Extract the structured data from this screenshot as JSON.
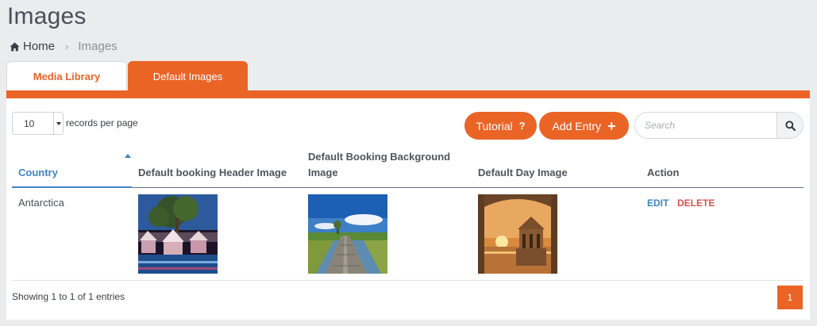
{
  "page": {
    "title": "Images"
  },
  "breadcrumb": {
    "home": "Home",
    "separator": "›",
    "current": "Images"
  },
  "tabs": [
    {
      "label": "Media Library",
      "active": false
    },
    {
      "label": "Default Images",
      "active": true
    }
  ],
  "colors": {
    "accent": "#ea6426",
    "link": "#3e85c6",
    "danger": "#d9534f"
  },
  "controls": {
    "page_length": "10",
    "records_label": "records per page",
    "tutorial_label": "Tutorial",
    "tutorial_icon": "?",
    "add_label": "Add Entry",
    "add_icon": "+",
    "search_placeholder": "Search"
  },
  "table": {
    "columns": [
      "Country",
      "Default booking Header Image",
      "Default Booking Background Image",
      "Default Day Image",
      "Action"
    ],
    "sorted_column": "Country",
    "rows": [
      {
        "country": "Antarctica",
        "header_image": "resort-pool-cabanas-image",
        "background_image": "boardwalk-lake-image",
        "day_image": "sunset-pavilion-image",
        "edit": "EDIT",
        "delete": "DELETE"
      }
    ]
  },
  "footer": {
    "info": "Showing 1 to 1 of 1 entries",
    "current_page": "1"
  }
}
